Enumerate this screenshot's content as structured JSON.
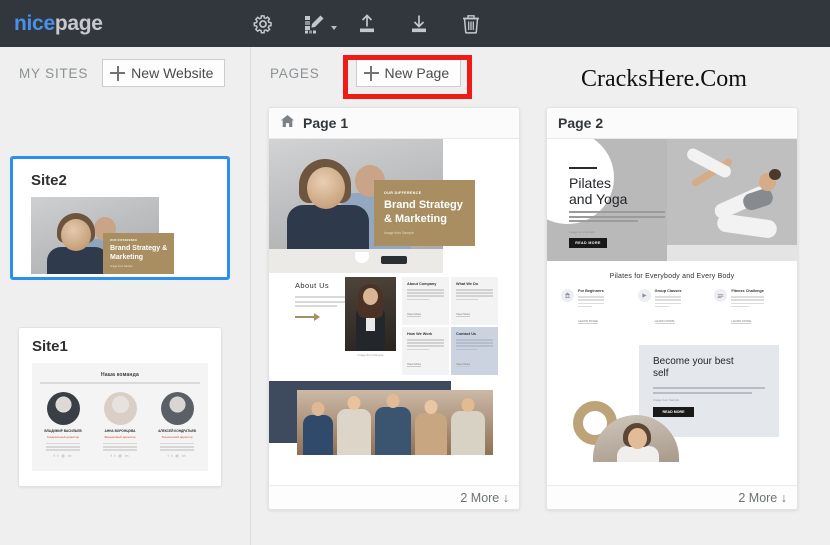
{
  "app": {
    "logo_nice": "nice",
    "logo_page": "page"
  },
  "toolbar": {
    "items": [
      {
        "name": "settings-icon",
        "label": "Settings"
      },
      {
        "name": "theme-icon",
        "label": "Theme"
      },
      {
        "name": "upload-icon",
        "label": "Upload"
      },
      {
        "name": "download-icon",
        "label": "Download"
      },
      {
        "name": "delete-icon",
        "label": "Delete"
      }
    ]
  },
  "sites": {
    "label": "MY SITES",
    "new_button": "New Website",
    "cards": [
      {
        "title": "Site2",
        "selected": true,
        "preview": {
          "kicker": "OUR DIFFERENCE",
          "title": "Brand Strategy & Marketing",
          "note": "Image from Sample"
        }
      },
      {
        "title": "Site1",
        "selected": false,
        "preview": {
          "heading": "Наша команда",
          "people": [
            {
              "name": "ВЛАДИМИР ВАСИЛЬЕВ",
              "role": "Генеральный директор"
            },
            {
              "name": "АННА ВОРОНЦОВА",
              "role": "Финансовый директор"
            },
            {
              "name": "АЛЕКСЕЙ КОНДРАТЬЕВ",
              "role": "Технический директор"
            }
          ]
        }
      }
    ]
  },
  "pages": {
    "label": "PAGES",
    "new_button": "New Page",
    "watermark": "CracksHere.Com",
    "cards": [
      {
        "title": "Page 1",
        "is_home": true,
        "more_label": "2 More",
        "more_arrow": "↓",
        "hero": {
          "kicker": "OUR DIFFERENCE",
          "title_line1": "Brand Strategy",
          "title_line2": "& Marketing",
          "note": "Image from Sample"
        },
        "about": {
          "heading": "About Us",
          "caption": "Image from Sample"
        },
        "tiles": [
          {
            "title": "About Company",
            "more": "View More",
            "highlight": false
          },
          {
            "title": "What We Do",
            "more": "View More",
            "highlight": false
          },
          {
            "title": "How We Work",
            "more": "View More",
            "highlight": false
          },
          {
            "title": "Contact Us",
            "more": "View More",
            "highlight": true
          }
        ]
      },
      {
        "title": "Page 2",
        "is_home": false,
        "more_label": "2 More",
        "more_arrow": "↓",
        "hero": {
          "title_line1": "Pilates",
          "title_line2": "and Yoga",
          "note": "Image by Unsplash",
          "button": "READ MORE"
        },
        "features": {
          "heading": "Pilates for Everybody and Every Body",
          "items": [
            {
              "title": "For Beginners",
              "more": "LEARN MORE"
            },
            {
              "title": "Group Classes",
              "more": "LEARN MORE"
            },
            {
              "title": "Fitness Challenge",
              "more": "LEARN MORE"
            }
          ]
        },
        "promo": {
          "title_line1": "Become your best",
          "title_line2": "self",
          "note": "Image from Sample",
          "button": "READ MORE"
        }
      }
    ]
  },
  "colors": {
    "topbar": "#32373d",
    "accent_blue": "#2a8ff0",
    "annotation_red": "#ee1b17",
    "brand_tan": "#a98e62"
  }
}
